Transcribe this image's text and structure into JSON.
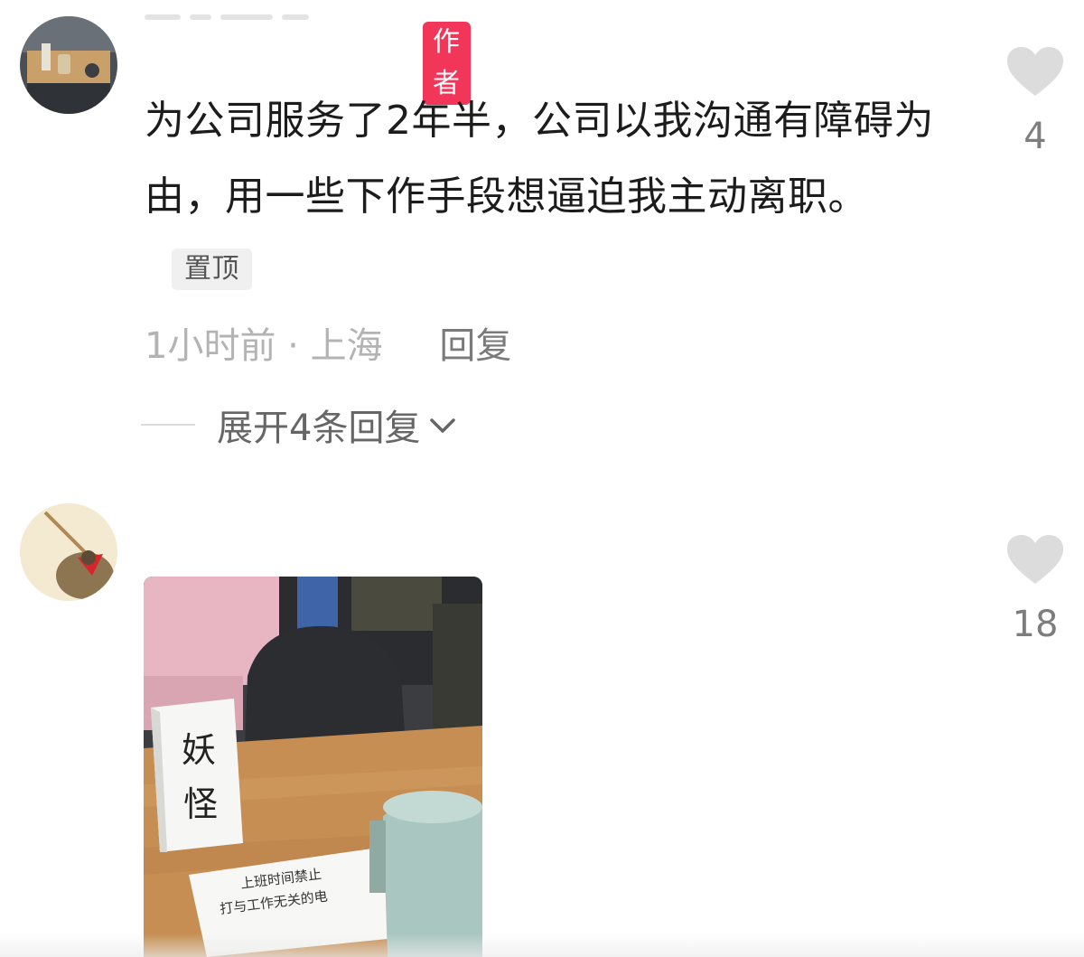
{
  "comments": [
    {
      "author_badge": "作者",
      "text": "为公司服务了2年半，公司以我沟通有障碍为由，用一些下作手段想逼迫我主动离职。",
      "pin_badge": "置顶",
      "time": "1小时前",
      "separator": " · ",
      "location": "上海",
      "reply_label": "回复",
      "expand_label": "展开4条回复",
      "like_count": "4",
      "like_icon": "heart-icon"
    },
    {
      "like_count": "18",
      "like_icon": "heart-icon",
      "photo": {
        "sign_line1": "妖",
        "sign_line2": "怪",
        "notice_line1": "上班时间禁止",
        "notice_line2": "打与工作无关的电"
      }
    }
  ],
  "colors": {
    "author_badge": "#f2365a",
    "pin_badge_bg": "#f0f0f0",
    "like_heart": "#dcdcdc",
    "meta_text": "#b3b3b3"
  }
}
